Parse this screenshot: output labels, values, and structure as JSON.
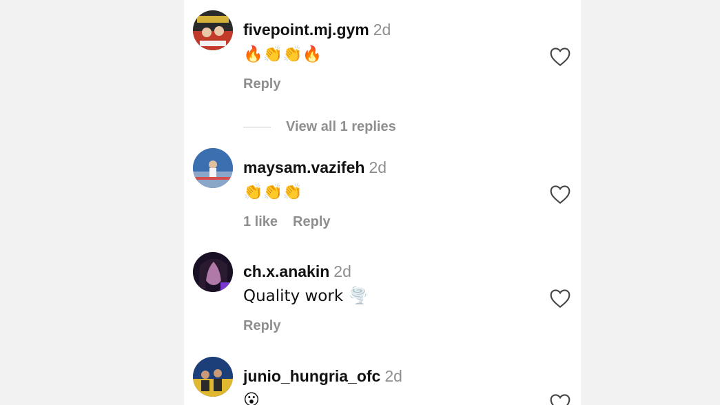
{
  "comments": [
    {
      "username": "fivepoint.mj.gym",
      "time": "2d",
      "text": "🔥👏👏🔥",
      "likes": "",
      "reply": "Reply",
      "view_replies": "View all 1 replies"
    },
    {
      "username": "maysam.vazifeh",
      "time": "2d",
      "text": "👏👏👏",
      "likes": "1 like",
      "reply": "Reply"
    },
    {
      "username": "ch.x.anakin",
      "time": "2d",
      "text": "Quality work 🌪️",
      "likes": "",
      "reply": "Reply"
    },
    {
      "username": "junio_hungria_ofc",
      "time": "2d",
      "text": "😮",
      "likes": "",
      "reply": ""
    }
  ],
  "icons": {
    "like": "heart-outline-icon"
  },
  "colors": {
    "primary_text": "#111111",
    "secondary_text": "#8e8e8e",
    "background": "#ffffff"
  }
}
